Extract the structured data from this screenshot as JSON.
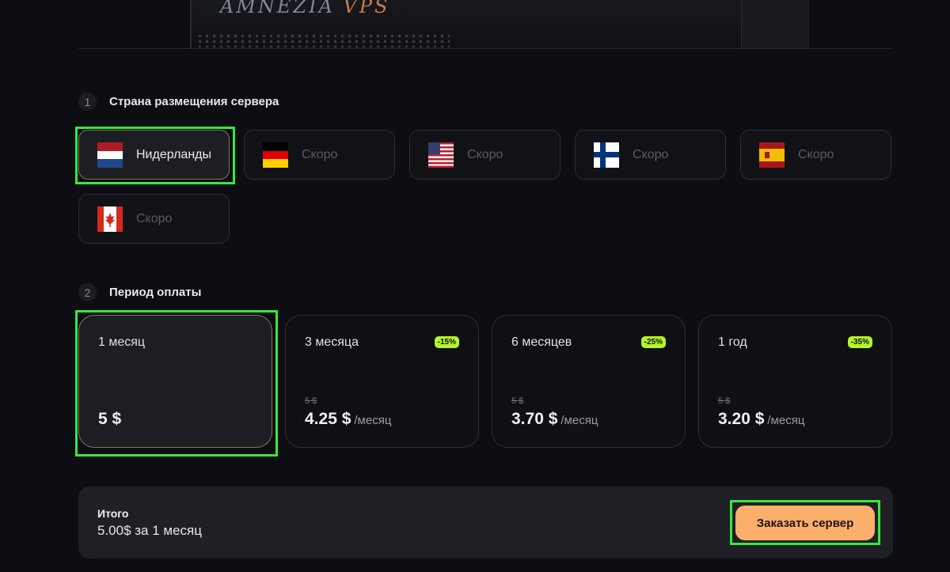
{
  "hero": {
    "logo_main": "AMNEZIA ",
    "logo_accent": "VPS"
  },
  "step1": {
    "number": "1",
    "title": "Страна размещения сервера"
  },
  "countries": [
    {
      "label": "Нидерланды",
      "flag": "netherlands-flag",
      "selected": true
    },
    {
      "label": "Скоро",
      "flag": "germany-flag"
    },
    {
      "label": "Скоро",
      "flag": "usa-flag"
    },
    {
      "label": "Скоро",
      "flag": "finland-flag"
    },
    {
      "label": "Скоро",
      "flag": "spain-flag"
    },
    {
      "label": "Скоро",
      "flag": "canada-flag"
    }
  ],
  "step2": {
    "number": "2",
    "title": "Период оплаты"
  },
  "periods": [
    {
      "name": "1 месяц",
      "price": "5 $",
      "selected": true
    },
    {
      "name": "3 месяца",
      "badge": "-15%",
      "old_price": "5 $",
      "price": "4.25 $",
      "per": "/месяц"
    },
    {
      "name": "6 месяцев",
      "badge": "-25%",
      "old_price": "5 $",
      "price": "3.70 $",
      "per": "/месяц"
    },
    {
      "name": "1 год",
      "badge": "-35%",
      "old_price": "5 $",
      "price": "3.20 $",
      "per": "/месяц"
    }
  ],
  "total": {
    "label": "Итого",
    "value": "5.00$ за 1 месяц",
    "button": "Заказать сервер"
  },
  "colors": {
    "accent": "#fcae6b",
    "badge": "#b5f52a",
    "highlight": "#37e83b"
  }
}
